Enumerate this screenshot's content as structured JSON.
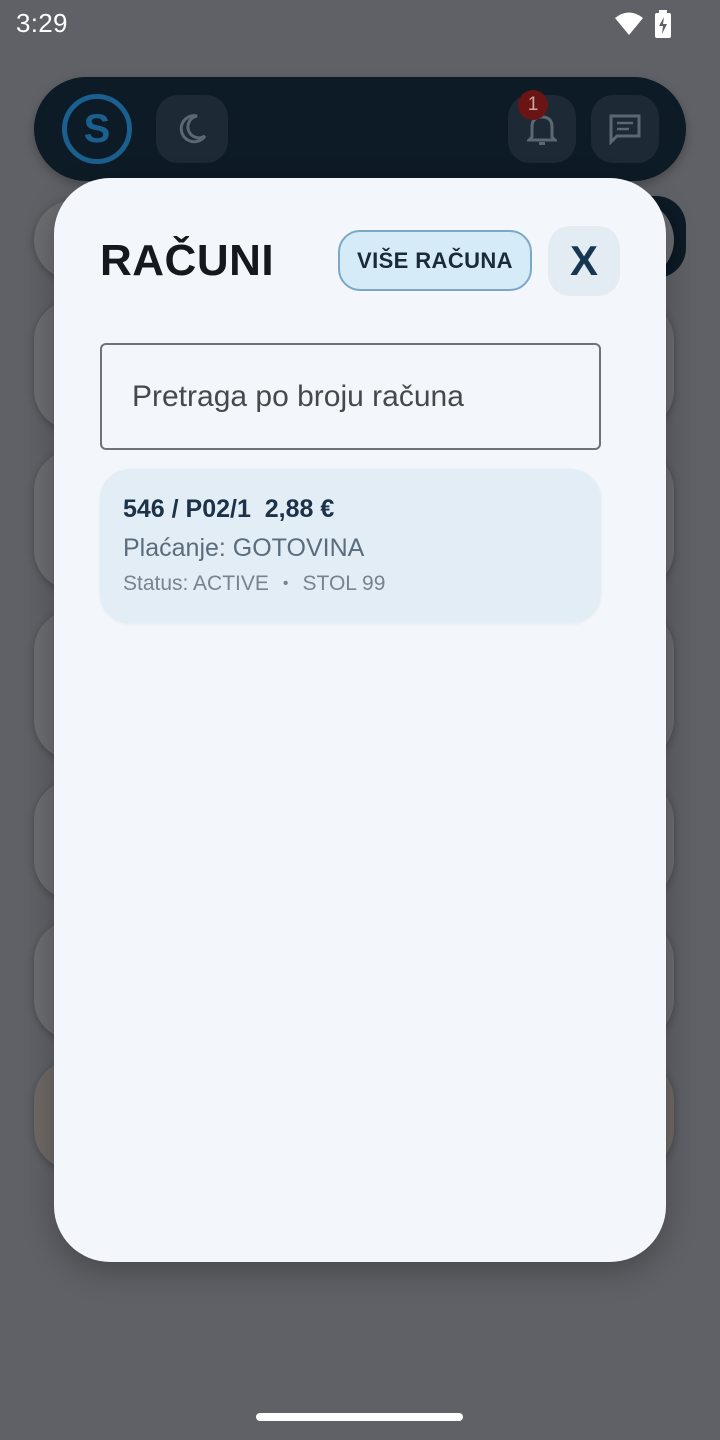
{
  "status_bar": {
    "time": "3:29",
    "icons": [
      "wifi-icon",
      "battery-charging-icon"
    ]
  },
  "header": {
    "logo_glyph": "S",
    "notification_count": "1",
    "icons": [
      "moon-icon",
      "bell-icon",
      "chat-icon"
    ]
  },
  "modal": {
    "title": "RAČUNI",
    "more_button": "VIŠE RAČUNA",
    "close_button": "X",
    "search_placeholder": "Pretraga po broju računa",
    "receipts": [
      {
        "title": "546 / P02/1  2,88 €",
        "payment": "Plaćanje: GOTOVINA",
        "status": "Status: ACTIVE",
        "separator": "•",
        "table": "STOL 99"
      }
    ]
  },
  "colors": {
    "header_bg": "#0d1b26",
    "modal_bg": "#f3f7fb",
    "card_bg": "#e3edf6",
    "accent_button_bg": "#d6ebf8",
    "accent_text": "#1b3248",
    "badge": "#6b1414"
  }
}
